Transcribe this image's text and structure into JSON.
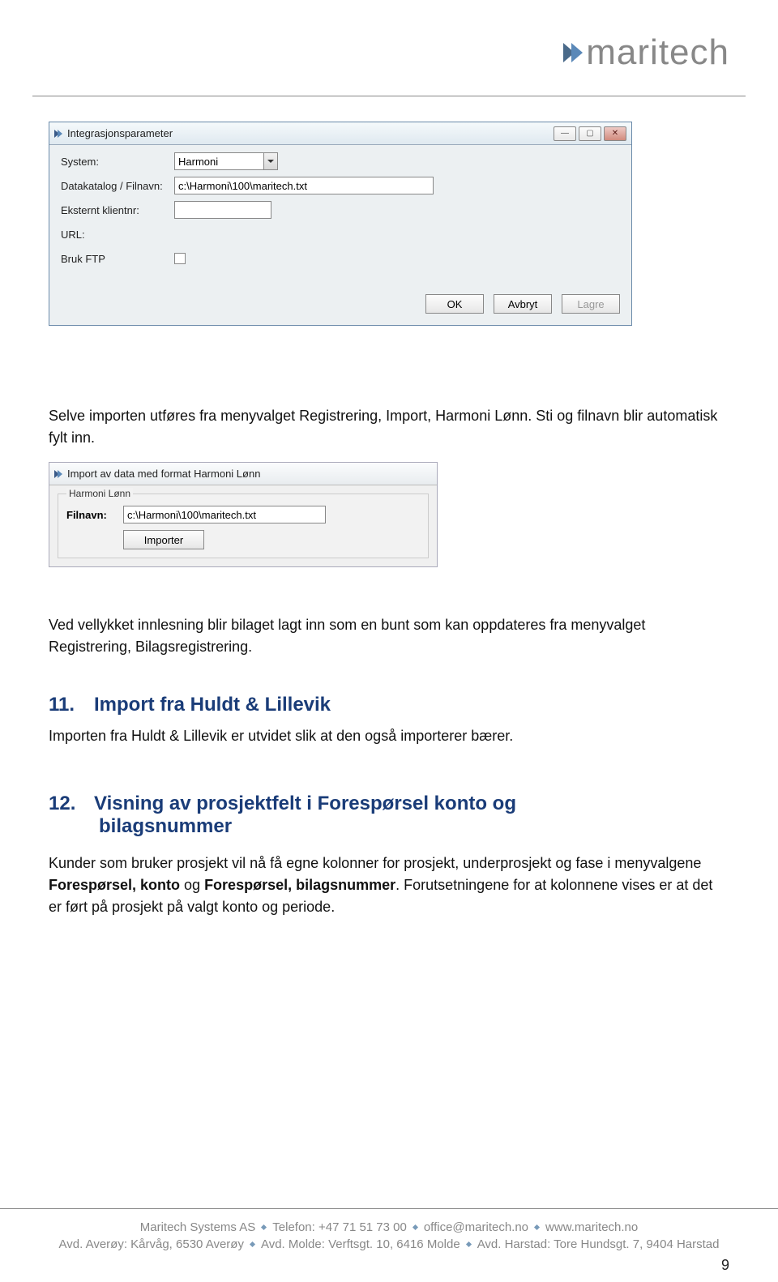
{
  "logo": {
    "text": "maritech"
  },
  "dialog1": {
    "title": "Integrasjonsparameter",
    "labels": {
      "system": "System:",
      "datakatalog": "Datakatalog / Filnavn:",
      "eksternt": "Eksternt klientnr:",
      "url": "URL:",
      "brukftp": "Bruk FTP"
    },
    "values": {
      "system": "Harmoni",
      "datakatalog": "c:\\Harmoni\\100\\maritech.txt",
      "eksternt": "",
      "url": ""
    },
    "buttons": {
      "ok": "OK",
      "avbryt": "Avbryt",
      "lagre": "Lagre"
    }
  },
  "para1": "Selve importen utføres fra menyvalget Registrering, Import, Harmoni Lønn. Sti og filnavn blir automatisk fylt inn.",
  "dialog2": {
    "title": "Import av data med format Harmoni Lønn",
    "legend": "Harmoni Lønn",
    "filnavn_label": "Filnavn:",
    "filnavn_value": "c:\\Harmoni\\100\\maritech.txt",
    "importer_btn": "Importer"
  },
  "para2": "Ved vellykket innlesning blir bilaget lagt inn som en bunt som kan oppdateres fra menyvalget Registrering, Bilagsregistrering.",
  "h11_num": "11.",
  "h11_title": "Import fra Huldt & Lillevik",
  "para3": "Importen fra Huldt & Lillevik er utvidet slik at den også importerer bærer.",
  "h12_num": "12.",
  "h12_title_line1": "Visning av prosjektfelt i Forespørsel konto og",
  "h12_title_line2": "bilagsnummer",
  "para4_a": "Kunder som bruker prosjekt vil nå få egne kolonner for prosjekt, underprosjekt og fase i menyvalgene ",
  "para4_b": "Forespørsel, konto",
  "para4_c": " og ",
  "para4_d": "Forespørsel, bilagsnummer",
  "para4_e": ". Forutsetningene for at kolonnene vises er at det er ført på prosjekt på valgt konto og periode.",
  "footer": {
    "company": "Maritech Systems AS",
    "tel": "Telefon: +47 71 51 73 00",
    "email": "office@maritech.no",
    "web": "www.maritech.no",
    "addr1": "Avd. Averøy: Kårvåg, 6530 Averøy",
    "addr2": "Avd. Molde: Verftsgt. 10, 6416 Molde",
    "addr3": "Avd. Harstad: Tore Hundsgt. 7, 9404 Harstad"
  },
  "page_num": "9"
}
